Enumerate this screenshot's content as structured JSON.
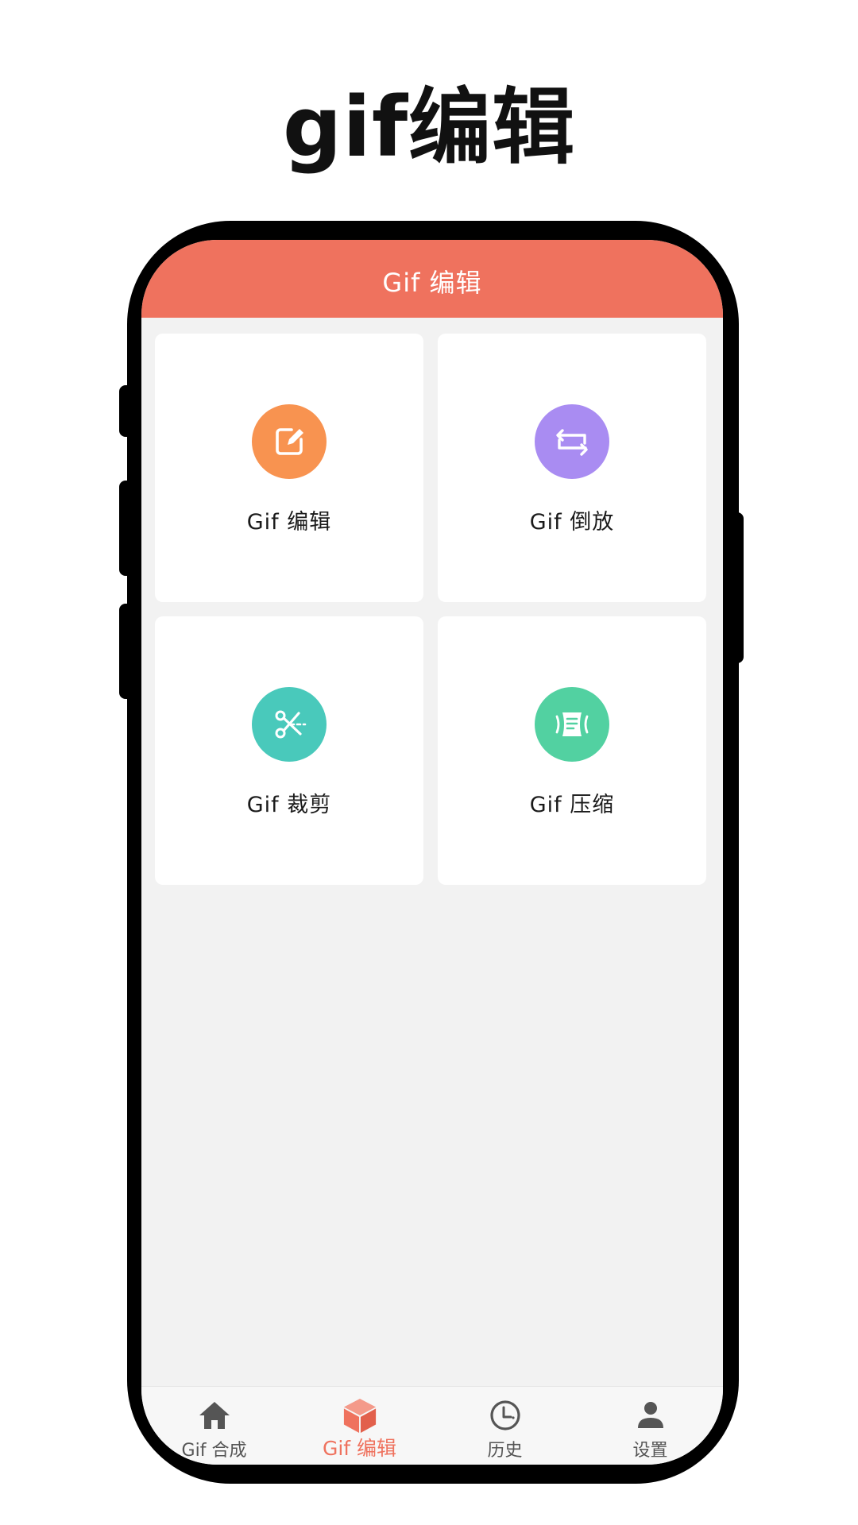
{
  "promo": {
    "title": "gif编辑"
  },
  "header": {
    "title": "Gif 编辑"
  },
  "tools": [
    {
      "label": "Gif 编辑",
      "icon": "edit-icon",
      "color": "#f89350"
    },
    {
      "label": "Gif 倒放",
      "icon": "reverse-loop-icon",
      "color": "#a98cf2"
    },
    {
      "label": "Gif 裁剪",
      "icon": "scissors-icon",
      "color": "#49c9bb"
    },
    {
      "label": "Gif 压缩",
      "icon": "compress-icon",
      "color": "#52d1a1"
    }
  ],
  "tabbar": {
    "active_index": 1,
    "active_color": "#ef725e",
    "items": [
      {
        "label": "Gif 合成",
        "icon": "home-icon"
      },
      {
        "label": "Gif 编辑",
        "icon": "cube-icon"
      },
      {
        "label": "历史",
        "icon": "clock-icon"
      },
      {
        "label": "设置",
        "icon": "user-icon"
      }
    ]
  },
  "colors": {
    "header_bg": "#ef725e",
    "screen_bg": "#f2f2f2"
  }
}
